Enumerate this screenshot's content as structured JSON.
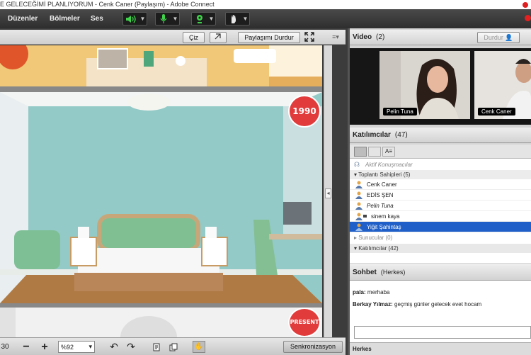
{
  "window": {
    "title": "E GELECEĞİMİ PLANLIYORUM - Cenk Caner (Paylaşım) - Adobe Connect"
  },
  "menu": {
    "items": [
      "Düzenler",
      "Bölmeler",
      "Ses"
    ]
  },
  "share": {
    "draw_button": "Çiz",
    "stop_share_button": "Paylaşımı Durdur",
    "sync_button": "Senkronizasyon",
    "zoom": "%92",
    "page_partial": "30",
    "badge_top": "1990",
    "badge_bottom": "PRESENT"
  },
  "video": {
    "title": "Video",
    "count": "(2)",
    "stop_button": "Durdur",
    "participants": [
      "Pelin Tuna",
      "Cenk Caner"
    ]
  },
  "attendees": {
    "title": "Katılımcılar",
    "count": "(47)",
    "active_speakers": "Aktif Konuşmacılar",
    "hosts_group": "Toplantı Sahipleri (5)",
    "hosts": [
      {
        "name": "Cenk Caner"
      },
      {
        "name": "EDİS ŞEN"
      },
      {
        "name": "Pelin Tuna"
      },
      {
        "name": "sinem kaya"
      },
      {
        "name": "Yiğit Şahintaş"
      }
    ],
    "presenters_group": "Sunucular (0)",
    "participants_group": "Katılımcılar (42)"
  },
  "chat": {
    "title": "Sohbet",
    "scope": "(Herkes)",
    "messages": [
      {
        "sender": "pala:",
        "text": "merhaba"
      },
      {
        "sender": "Berkay Yılmaz:",
        "text": "geçmiş günler gelecek evet hocam"
      }
    ],
    "tab": "Herkes"
  },
  "colors": {
    "selected_row": "#1f5fc7",
    "badge": "#e23b3b",
    "speaking_icon": "#2ecc40"
  }
}
